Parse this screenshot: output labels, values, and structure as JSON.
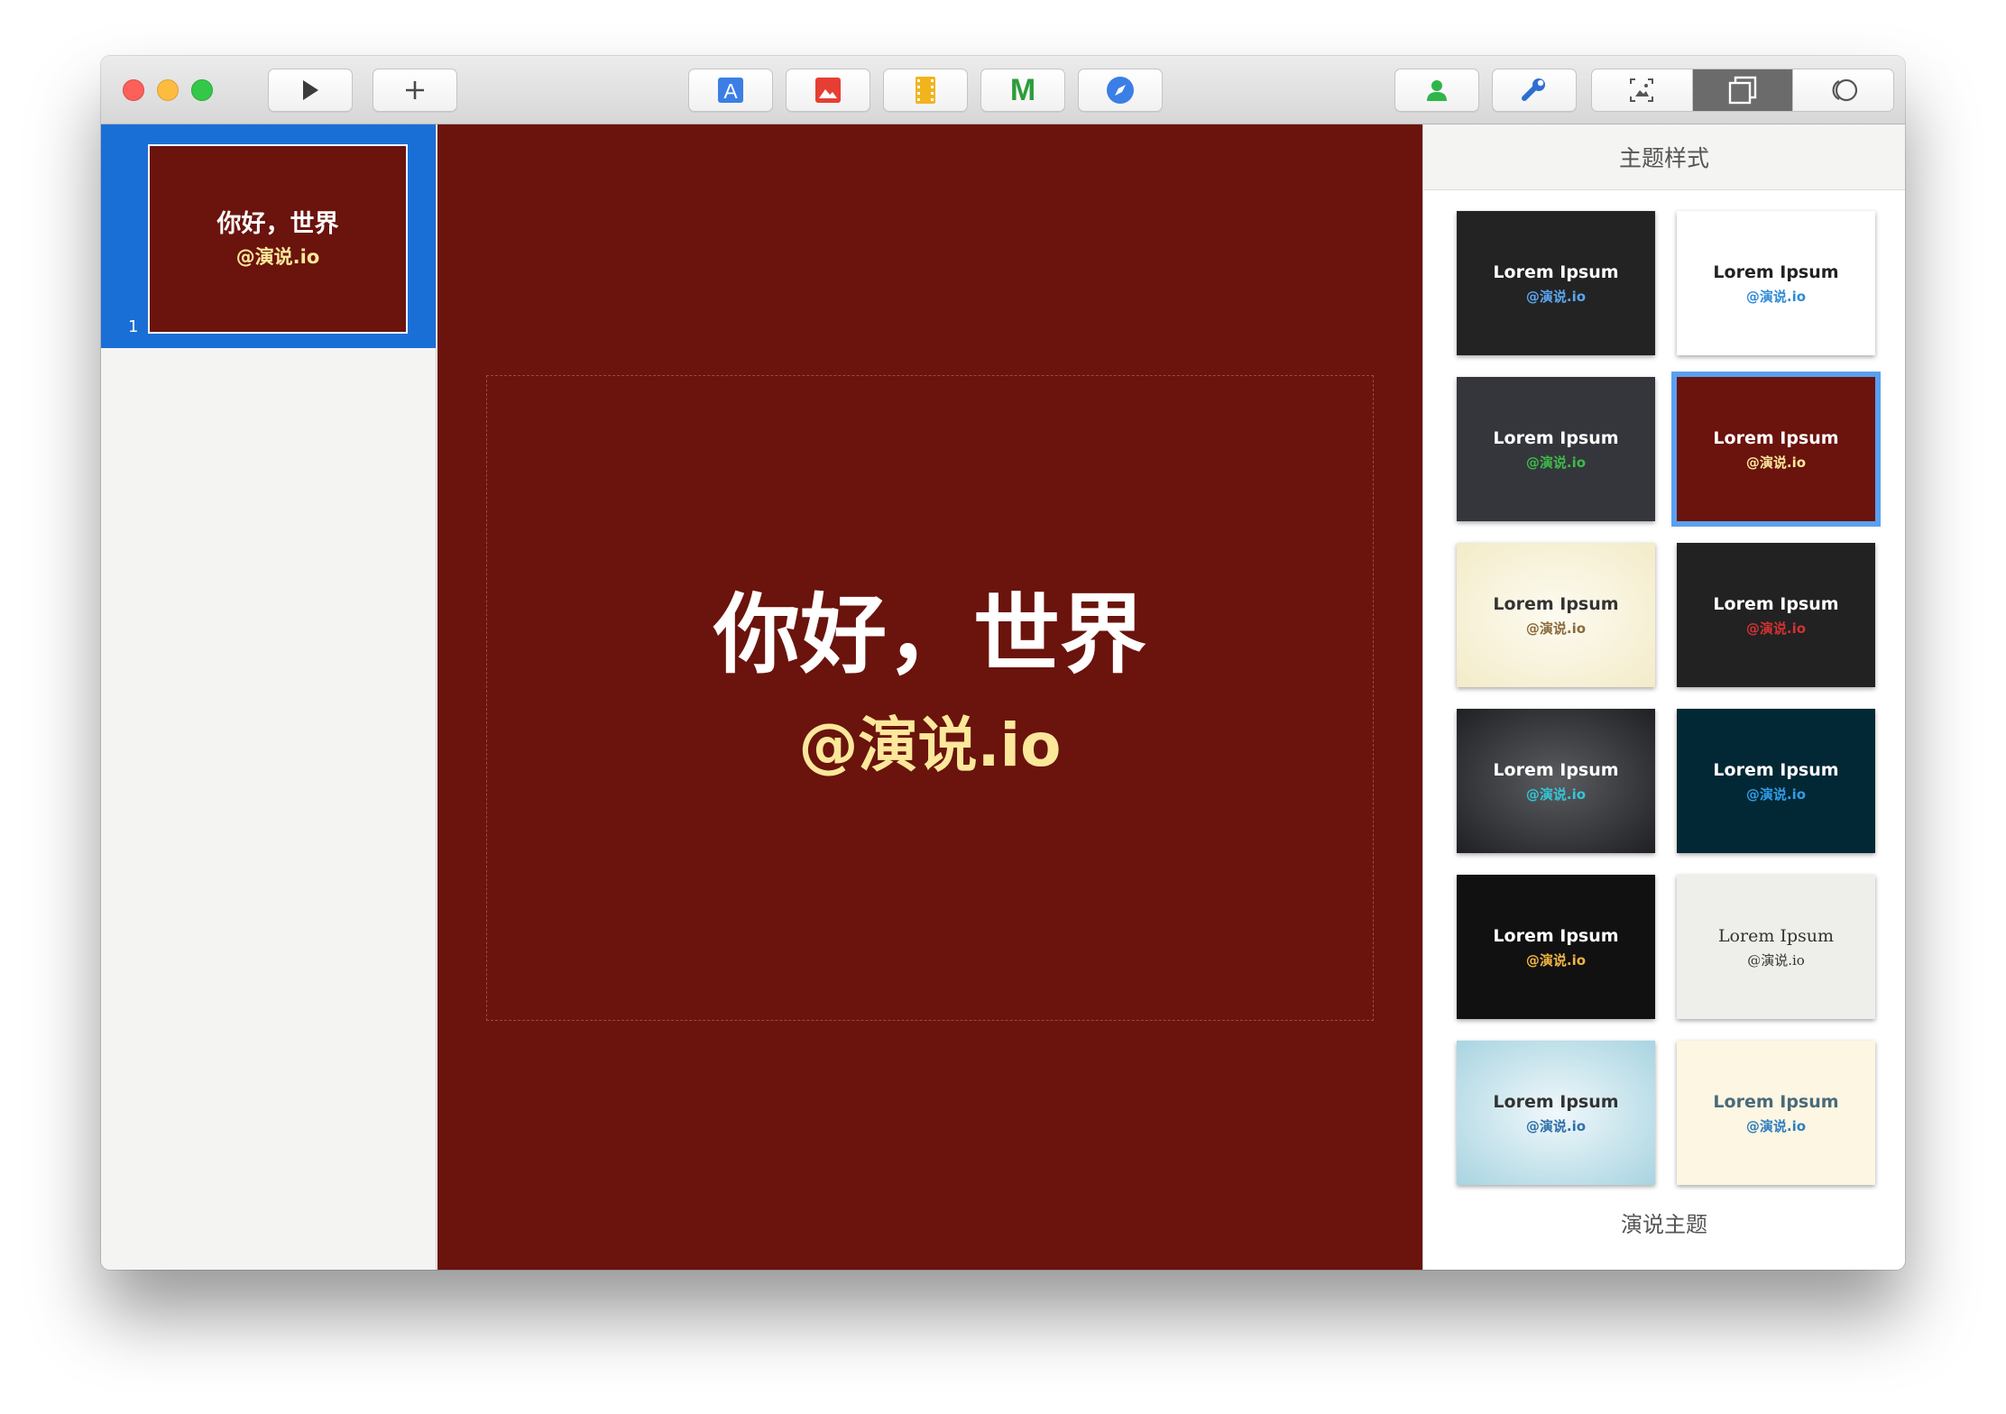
{
  "slides": {
    "items": [
      {
        "number": "1",
        "title": "你好，世界",
        "subtitle": "@演说.io"
      }
    ]
  },
  "slide": {
    "title": "你好，世界",
    "subtitle": "@演说.io",
    "background": "#6b130d",
    "title_color": "#ffffff",
    "subtitle_color": "#fbe89b"
  },
  "panel": {
    "title": "主题样式",
    "footer": "演说主题",
    "themes": [
      {
        "title": "Lorem Ipsum",
        "subtitle": "@演说.io",
        "bg": "#232323",
        "title_color": "#ffffff",
        "subtitle_color": "#5aa6f0",
        "selected": false
      },
      {
        "title": "Lorem Ipsum",
        "subtitle": "@演说.io",
        "bg": "#ffffff",
        "title_color": "#222222",
        "subtitle_color": "#2f8ad8",
        "selected": false
      },
      {
        "title": "Lorem Ipsum",
        "subtitle": "@演说.io",
        "bg": "#34363b",
        "title_color": "#ffffff",
        "subtitle_color": "#3dbb4a",
        "selected": false
      },
      {
        "title": "Lorem Ipsum",
        "subtitle": "@演说.io",
        "bg": "#6b130d",
        "title_color": "#ffffff",
        "subtitle_color": "#fbe89b",
        "selected": true
      },
      {
        "title": "Lorem Ipsum",
        "subtitle": "@演说.io",
        "bg": "#f8f3dc",
        "title_color": "#333333",
        "subtitle_color": "#8a6a3a",
        "selected": false
      },
      {
        "title": "Lorem Ipsum",
        "subtitle": "@演说.io",
        "bg": "#222222",
        "title_color": "#ffffff",
        "subtitle_color": "#d23232",
        "selected": false
      },
      {
        "title": "Lorem Ipsum",
        "subtitle": "@演说.io",
        "bg": "#3a3c3f",
        "title_color": "#ffffff",
        "subtitle_color": "#33c6d8",
        "selected": false
      },
      {
        "title": "Lorem Ipsum",
        "subtitle": "@演说.io",
        "bg": "#022835",
        "title_color": "#ffffff",
        "subtitle_color": "#2f9de8",
        "selected": false
      },
      {
        "title": "Lorem Ipsum",
        "subtitle": "@演说.io",
        "bg": "#111111",
        "title_color": "#ffffff",
        "subtitle_color": "#f0b441",
        "selected": false
      },
      {
        "title": "Lorem Ipsum",
        "subtitle": "@演说.io",
        "bg": "#eeeeea",
        "title_color": "#333333",
        "subtitle_color": "#333333",
        "selected": false
      },
      {
        "title": "Lorem Ipsum",
        "subtitle": "@演说.io",
        "bg": "#cfe8ee",
        "title_color": "#333333",
        "subtitle_color": "#2f6fa8",
        "selected": false
      },
      {
        "title": "Lorem Ipsum",
        "subtitle": "@演说.io",
        "bg": "#fcf6e2",
        "title_color": "#4a6a7a",
        "subtitle_color": "#2f7ec0",
        "selected": false
      }
    ]
  },
  "toolbar": {
    "play": "play-icon",
    "add": "plus-icon",
    "insert": [
      "text-icon",
      "image-icon",
      "video-icon",
      "markdown-icon",
      "compass-icon"
    ],
    "markdown_glyph": "M",
    "text_glyph": "A",
    "right": [
      "person-icon",
      "wrench-icon"
    ],
    "view_segments": [
      "preview-icon",
      "slides-icon",
      "theme-icon"
    ]
  }
}
